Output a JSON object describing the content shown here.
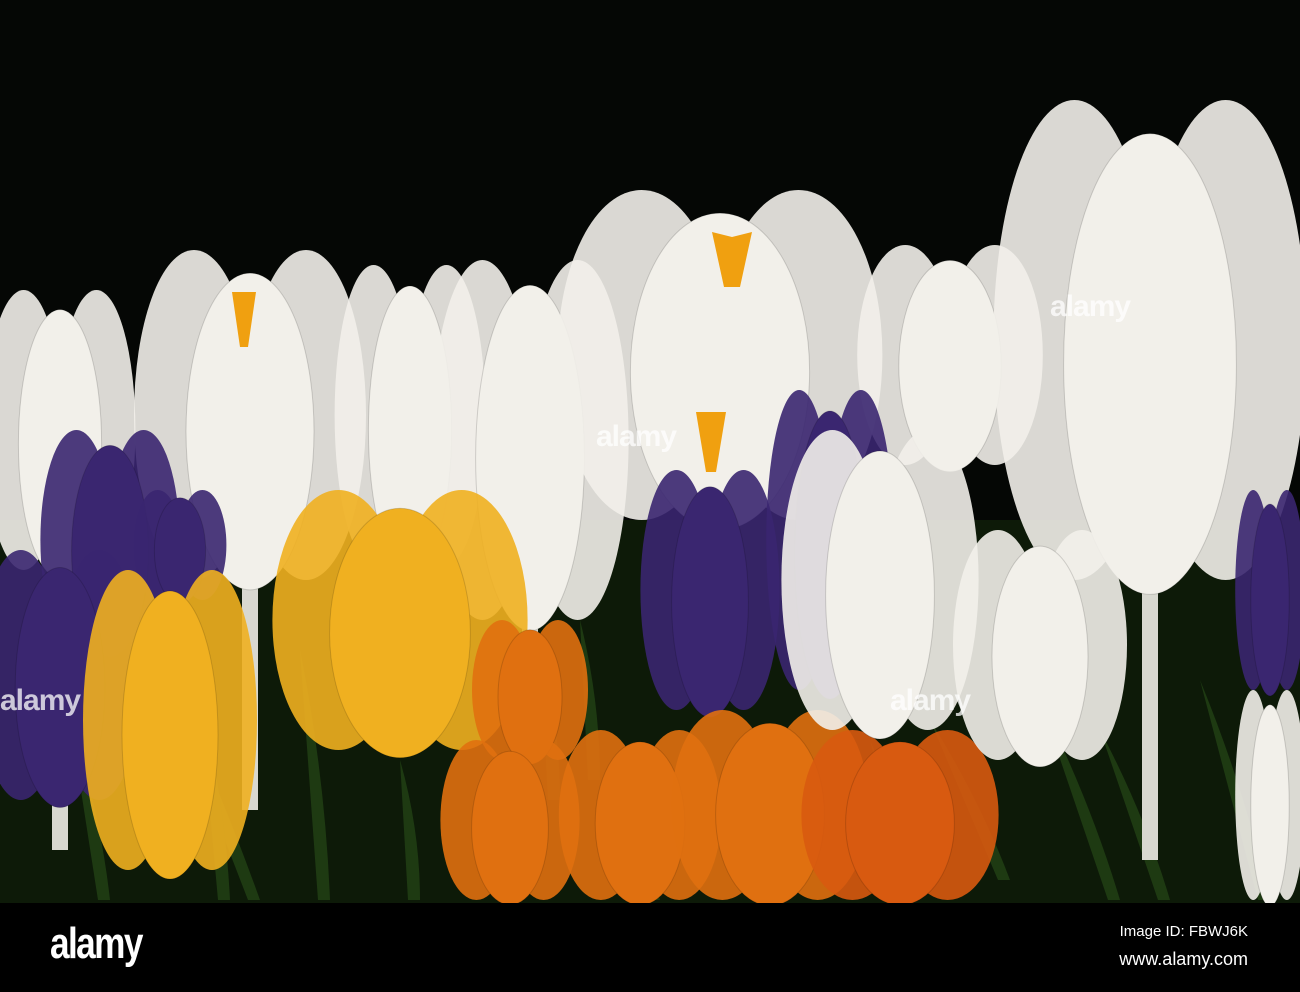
{
  "photo": {
    "subject": "crocus flowers",
    "colors": {
      "background": "#050705",
      "white": "#f2f0ea",
      "yellow": "#f0b020",
      "orange": "#e07010",
      "purple": "#3a2670",
      "leaf": "#1e3a12",
      "stamen": "#f0a010"
    }
  },
  "watermark": {
    "overlay_text": "alamy"
  },
  "footer": {
    "logo": "alamy",
    "image_id": "Image ID: FBWJ6K",
    "site": "www.alamy.com"
  }
}
